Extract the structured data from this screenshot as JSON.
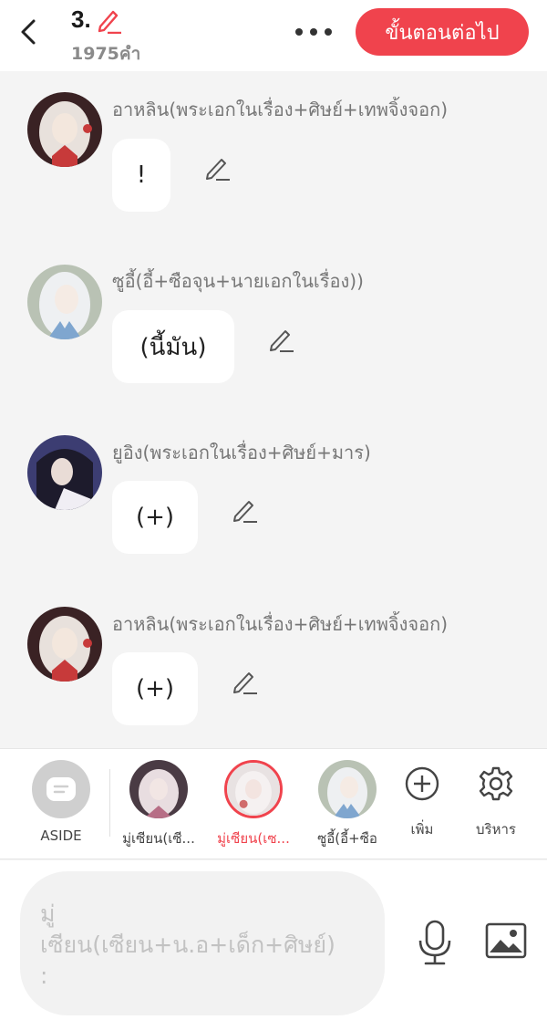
{
  "header": {
    "chapter_number": "3.",
    "word_count": "1975คำ",
    "next_button": "ขั้นตอนต่อไป",
    "icons": {
      "back": "back-arrow-icon",
      "edit": "pencil-icon",
      "more": "more-dots-icon"
    },
    "accent_color": "#f0434d"
  },
  "messages": [
    {
      "speaker": "อาหลิน(พระเอกในเรื่อง+ศิษย์+เทพจิ้งจอก)",
      "text": "!"
    },
    {
      "speaker": "ซูอี้(อี้+ซือจุน+นายเอกในเรื่อง))",
      "text": "(นี้มัน)"
    },
    {
      "speaker": "ยูอิง(พระเอกในเรื่อง+ศิษย์+มาร)",
      "text": "(+)"
    },
    {
      "speaker": "อาหลิน(พระเอกในเรื่อง+ศิษย์+เทพจิ้งจอก)",
      "text": "(+)"
    }
  ],
  "characters": {
    "aside_label": "ASIDE",
    "items": [
      {
        "label": "มู่เซียน(เซี...",
        "selected": false
      },
      {
        "label": "มู่เซียน(เซ...",
        "selected": true
      },
      {
        "label": "ซูอี้(อี้+ซือ",
        "selected": false
      }
    ],
    "add_label": "เพิ่ม",
    "manage_label": "บริหาร"
  },
  "input": {
    "placeholder_line1": "มู่",
    "placeholder_line2": "เซียน(เซียน+น.อ+เด็ก+ศิษย์)",
    "placeholder_line3": ":",
    "icons": {
      "mic": "microphone-icon",
      "image": "image-icon"
    }
  }
}
